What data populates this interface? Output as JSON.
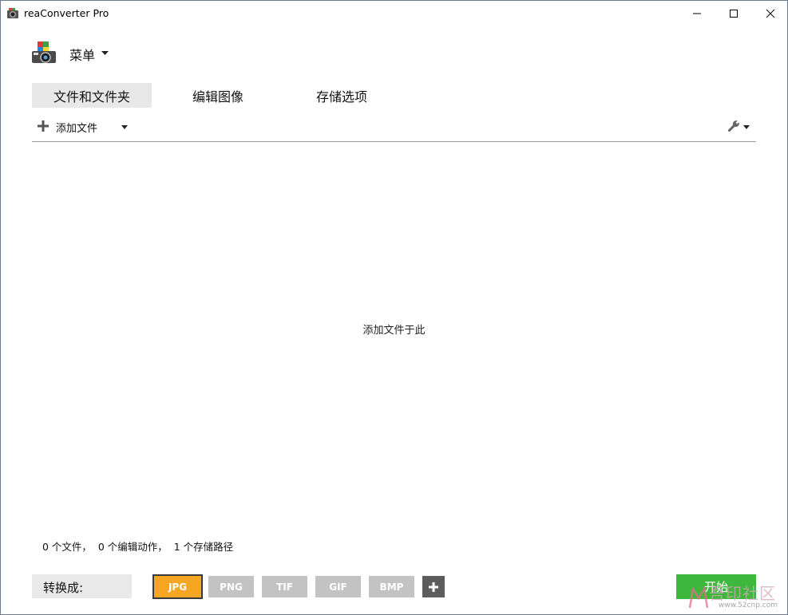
{
  "window": {
    "title": "reaConverter Pro"
  },
  "menu": {
    "label": "菜单"
  },
  "tabs": [
    {
      "label": "文件和文件夹",
      "active": true
    },
    {
      "label": "编辑图像",
      "active": false
    },
    {
      "label": "存储选项",
      "active": false
    }
  ],
  "toolbar": {
    "add_files_label": "添加文件"
  },
  "drop_area": {
    "hint": "添加文件于此"
  },
  "status": {
    "text": "0 个文件，  0 个编辑动作，  1 个存储路径"
  },
  "convert": {
    "label": "转换成:",
    "formats": [
      "JPG",
      "PNG",
      "TIF",
      "GIF",
      "BMP"
    ],
    "selected": "JPG"
  },
  "start_button": {
    "label": "开始"
  },
  "watermark": {
    "main": "吾印社区",
    "site": "www.52cnp.com"
  },
  "colors": {
    "selected_format": "#f6a623",
    "format_inactive": "#c3c3c3",
    "start_button": "#3db83d",
    "active_tab_bg": "#e8e8e8"
  }
}
